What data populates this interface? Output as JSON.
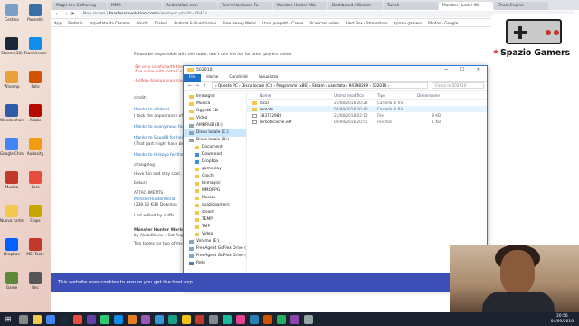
{
  "desktop": {
    "icons": [
      {
        "label": "Cestino",
        "color": "#7aa0c8"
      },
      {
        "label": "Steam (38)",
        "color": "#1b2838"
      },
      {
        "label": "Winamp",
        "color": "#e8a23b"
      },
      {
        "label": "Wondershare",
        "color": "#2f5aa8"
      },
      {
        "label": "Google Chrome",
        "color": "#4285f4"
      },
      {
        "label": "Musica",
        "color": "#c0392b"
      },
      {
        "label": "Nuova cartella",
        "color": "#f2c94c"
      },
      {
        "label": "Dropbox",
        "color": "#0061ff"
      },
      {
        "label": "Game",
        "color": "#5d8a3a"
      },
      {
        "label": "Pannello",
        "color": "#3a6ea5"
      },
      {
        "label": "TeamViewer",
        "color": "#0e8ee9"
      },
      {
        "label": "Foto",
        "color": "#d35400"
      },
      {
        "label": "Adobe",
        "color": "#b30b00"
      },
      {
        "label": "Audacity",
        "color": "#f39c12"
      },
      {
        "label": "Ears",
        "color": "#e74c3c"
      },
      {
        "label": "Fraps",
        "color": "#c8a600"
      },
      {
        "label": "MSI Tools",
        "color": "#c0392b"
      },
      {
        "label": "Rec",
        "color": "#555555"
      }
    ]
  },
  "browser": {
    "tabs": [
      "Magic the Gathering",
      "MMO",
      "Androidiani.com",
      "Tom's Hardware Fo",
      "Monster Hunter: Wo",
      "Dashboard / Stream",
      "Twitch",
      "Monster Hunter Wo",
      "Cheat Engine"
    ],
    "active_tab_index": 7,
    "nav": {
      "back": "←",
      "forward": "→",
      "reload": "⟳"
    },
    "security_label": "Non sicuro",
    "url_host": "fearlessrevolution.com",
    "url_path": "/viewtopic.php?t=7642s",
    "bookmarks": [
      "App",
      "Preferiti",
      "Importate da Chrome",
      "Giochi",
      "Dialoni",
      "Android & Rivisitazioni",
      "Free Heavy Metal",
      "I tuoi progetti - Canva",
      "Scaricare video",
      "Alert Box / Streamlabs",
      "spazio gamers",
      "Photos - Google"
    ]
  },
  "forum": {
    "lines": [
      {
        "text": "Please be responsible with this table, don't ruin the fun for other players online.",
        "style": "normal"
      },
      {
        "text": "-Be very careful with the",
        "style": "red"
      },
      {
        "text": "-The same with Insta-Co",
        "style": "red"
      },
      {
        "text": "-Hotkey backup your save",
        "style": "red"
      },
      {
        "text": "credit:",
        "style": "normal"
      },
      {
        "text": "thanks to stillkeld",
        "style": "blue"
      },
      {
        "text": "I took the appearance off",
        "style": "normal"
      },
      {
        "text": "thanks to anonymous for",
        "style": "blue"
      },
      {
        "text": "thanks to Squall8 for help",
        "style": "blue"
      },
      {
        "text": "(That part might have bee",
        "style": "normal"
      },
      {
        "text": "thanks to Hirkoyo for the",
        "style": "blue"
      },
      {
        "text": "changelog",
        "style": "normal"
      },
      {
        "text": "Have fun and stay cool,",
        "style": "normal"
      },
      {
        "text": "bokuri",
        "style": "normal"
      },
      {
        "text": "ATTACHMENTS",
        "style": "normal"
      },
      {
        "text": "MonsterHunterWorld",
        "style": "blue"
      },
      {
        "text": "(238.13 KiB) Downloa",
        "style": "normal"
      },
      {
        "text": "Last edited by sniffs",
        "style": "normal"
      },
      {
        "text": "Monster Hunter World",
        "style": "bold"
      },
      {
        "text": "by Aksaditions » Sat Aug",
        "style": "normal"
      },
      {
        "text": "Two tables for two of my f",
        "style": "normal"
      }
    ]
  },
  "explorer": {
    "title": "502010",
    "window_buttons": {
      "minimize": "—",
      "maximize": "☐",
      "close": "✕"
    },
    "ribbon_tabs": [
      "File",
      "Home",
      "Condividi",
      "Visualizza"
    ],
    "breadcrumb": "›  Questo PC  ›  Disco locale (C:)  ›  Programmi (x86)  ›  Steam  ›  userdata  ›  94398289  ›  502010  ›",
    "search_placeholder": "Cerca in 502010",
    "nav_items": [
      {
        "label": "Immagini",
        "kind": "folder",
        "sub": false
      },
      {
        "label": "Musica",
        "kind": "folder",
        "sub": false
      },
      {
        "label": "Oggetti 3D",
        "kind": "folder",
        "sub": false
      },
      {
        "label": "Video",
        "kind": "folder",
        "sub": false
      },
      {
        "label": "AMDRUB (B:)",
        "kind": "drive",
        "sub": false
      },
      {
        "label": "Disco locale (C:)",
        "kind": "drive",
        "sub": false,
        "selected": true
      },
      {
        "label": "Disco locale (D:)",
        "kind": "drive",
        "sub": false
      },
      {
        "label": "Documenti",
        "kind": "folder",
        "sub": true
      },
      {
        "label": "Download",
        "kind": "blue",
        "sub": true
      },
      {
        "label": "Dropbox",
        "kind": "blue",
        "sub": true
      },
      {
        "label": "gameplay",
        "kind": "folder",
        "sub": true
      },
      {
        "label": "Giochi",
        "kind": "folder",
        "sub": true
      },
      {
        "label": "Immagini",
        "kind": "folder",
        "sub": true
      },
      {
        "label": "MMORPG",
        "kind": "folder",
        "sub": true
      },
      {
        "label": "Musica",
        "kind": "folder",
        "sub": true
      },
      {
        "label": "spaziogamers",
        "kind": "folder",
        "sub": true
      },
      {
        "label": "steam",
        "kind": "folder",
        "sub": true
      },
      {
        "label": "TEMP",
        "kind": "folder",
        "sub": true
      },
      {
        "label": "TMP",
        "kind": "folder",
        "sub": true
      },
      {
        "label": "Video",
        "kind": "folder",
        "sub": true
      },
      {
        "label": "Volume (E:)",
        "kind": "drive",
        "sub": false
      },
      {
        "label": "FreeAgent GoFlex Drive (G:)",
        "kind": "drive",
        "sub": false
      },
      {
        "label": "FreeAgent GoFlex Drive (G:)",
        "kind": "drive",
        "sub": false
      },
      {
        "label": "Rete",
        "kind": "net",
        "sub": false
      }
    ],
    "columns": {
      "name": "Nome",
      "date": "Ultima modifica",
      "type": "Tipo",
      "size": "Dimensione"
    },
    "files": [
      {
        "name": "local",
        "date": "21/08/2018 20:28",
        "type": "Cartella di file",
        "size": "",
        "icon": "folder"
      },
      {
        "name": "remote",
        "date": "04/09/2018 20:40",
        "type": "Cartella di file",
        "size": "",
        "icon": "folder",
        "hover": true
      },
      {
        "name": "383712988",
        "date": "21/08/2018 02:13",
        "type": "File",
        "size": "8 KB",
        "icon": "doc"
      },
      {
        "name": "remotecache.vdf",
        "date": "04/09/2018 20:51",
        "type": "File VDF",
        "size": "1 KB",
        "icon": "doc"
      }
    ],
    "status": "4 elementi"
  },
  "cookie_banner": {
    "text": "This website uses cookies to ensure you get the best exp"
  },
  "overlay_logo": {
    "brand": "Spazio Gamers"
  },
  "taskbar": {
    "start": "⊞",
    "icons": [
      "#888888",
      "#f2c94c",
      "#4285f4",
      "#1b2838",
      "#e74c3c",
      "#6441a5",
      "#2ecc71",
      "#0e8ee9",
      "#e67e22",
      "#9b59b6",
      "#3498db",
      "#16a085",
      "#f1c40f",
      "#c0392b",
      "#7f8c8d",
      "#1abc9c",
      "#e84393",
      "#2980b9",
      "#d35400",
      "#27ae60",
      "#8e44ad",
      "#95a5a6"
    ],
    "time": "20:56",
    "date": "04/09/2018"
  }
}
